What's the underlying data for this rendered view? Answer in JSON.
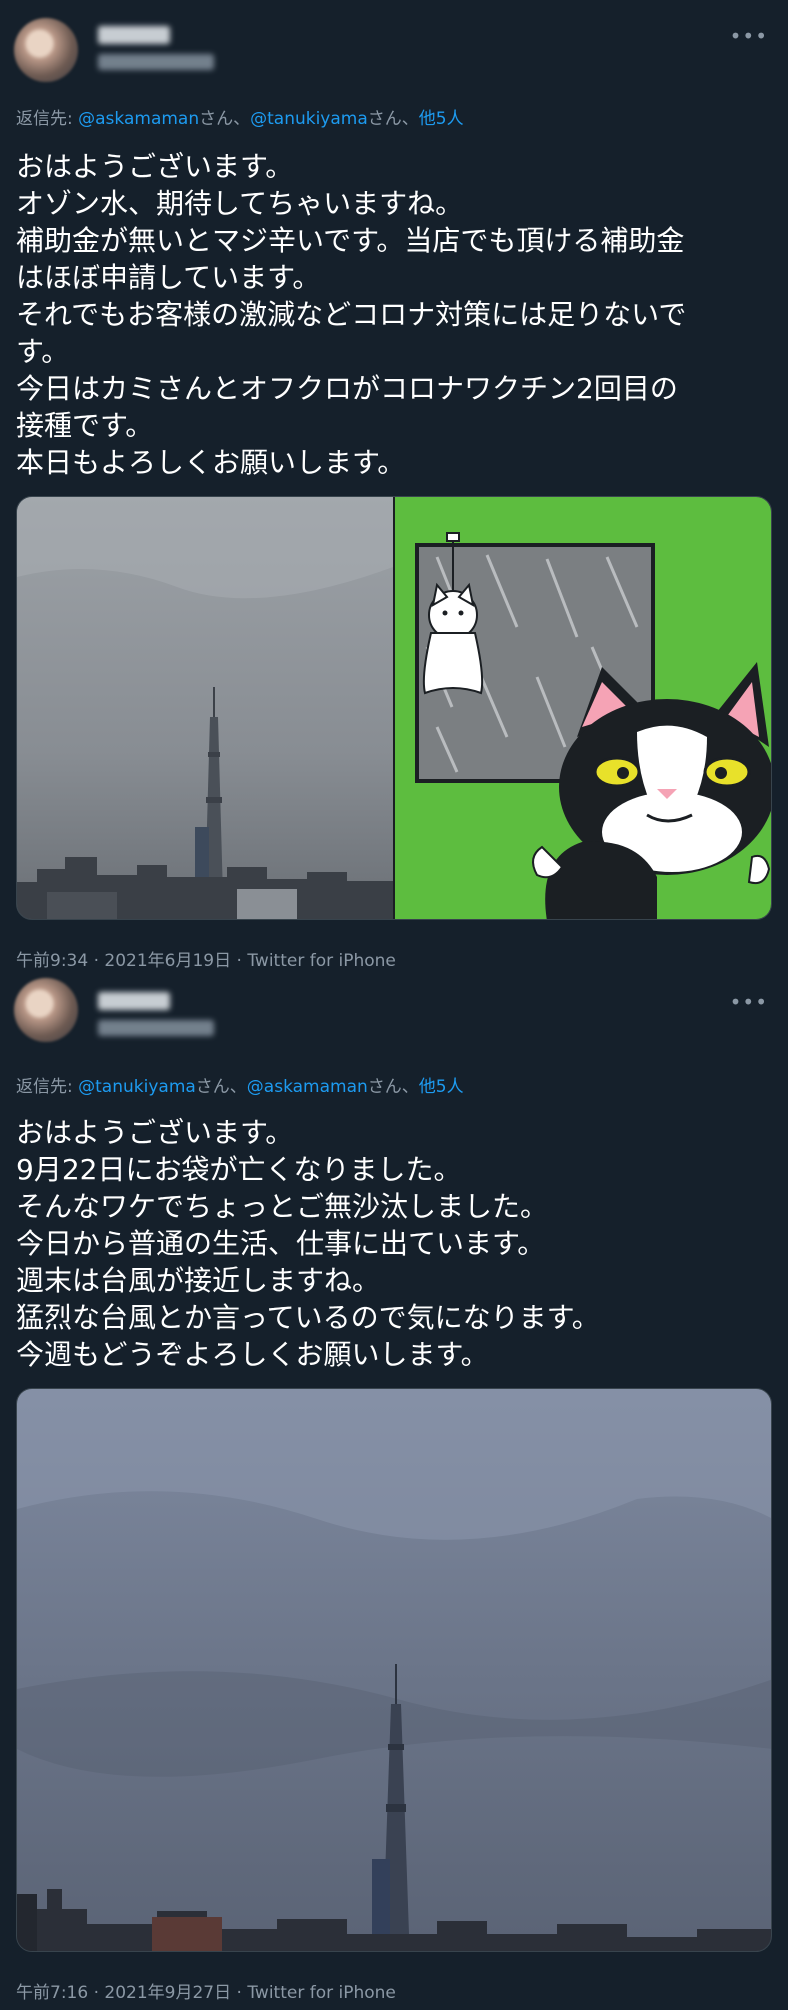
{
  "tweets": [
    {
      "replying_prefix": "返信先: ",
      "mention1": "@askamaman",
      "san1": "さん、",
      "mention2": "@tanukiyama",
      "san2": "さん、",
      "others": "他5人",
      "text": "おはようございます。\nオゾン水、期待してちゃいますね。\n補助金が無いとマジ辛いです。当店でも頂ける補助金\nはほぼ申請しています。\nそれでもお客様の激減などコロナ対策には足りないで\nす。\n今日はカミさんとオフクロがコロナワクチン2回目の\n接種です。\n本日もよろしくお願いします。",
      "time": "午前9:34",
      "date": "2021年6月19日",
      "client": "Twitter for iPhone"
    },
    {
      "replying_prefix": "返信先: ",
      "mention1": "@tanukiyama",
      "san1": "さん、",
      "mention2": "@askamaman",
      "san2": "さん、",
      "others": "他5人",
      "text": "おはようございます。\n9月22日にお袋が亡くなりました。\nそんなワケでちょっとご無沙汰しました。\n今日から普通の生活、仕事に出ています。\n週末は台風が接近しますね。\n猛烈な台風とか言っているので気になります。\n今週もどうぞよろしくお願いします。",
      "time": "午前7:16",
      "date": "2021年9月27日",
      "client": "Twitter for iPhone"
    }
  ],
  "ui": {
    "more_icon": "more-horizontal-icon",
    "dot": " · ",
    "more_glyph": "•••"
  },
  "colors": {
    "background": "#15202b",
    "link": "#1d9bf0",
    "secondary": "#8b98a5",
    "cat_panel_green": "#5dbd3f"
  }
}
